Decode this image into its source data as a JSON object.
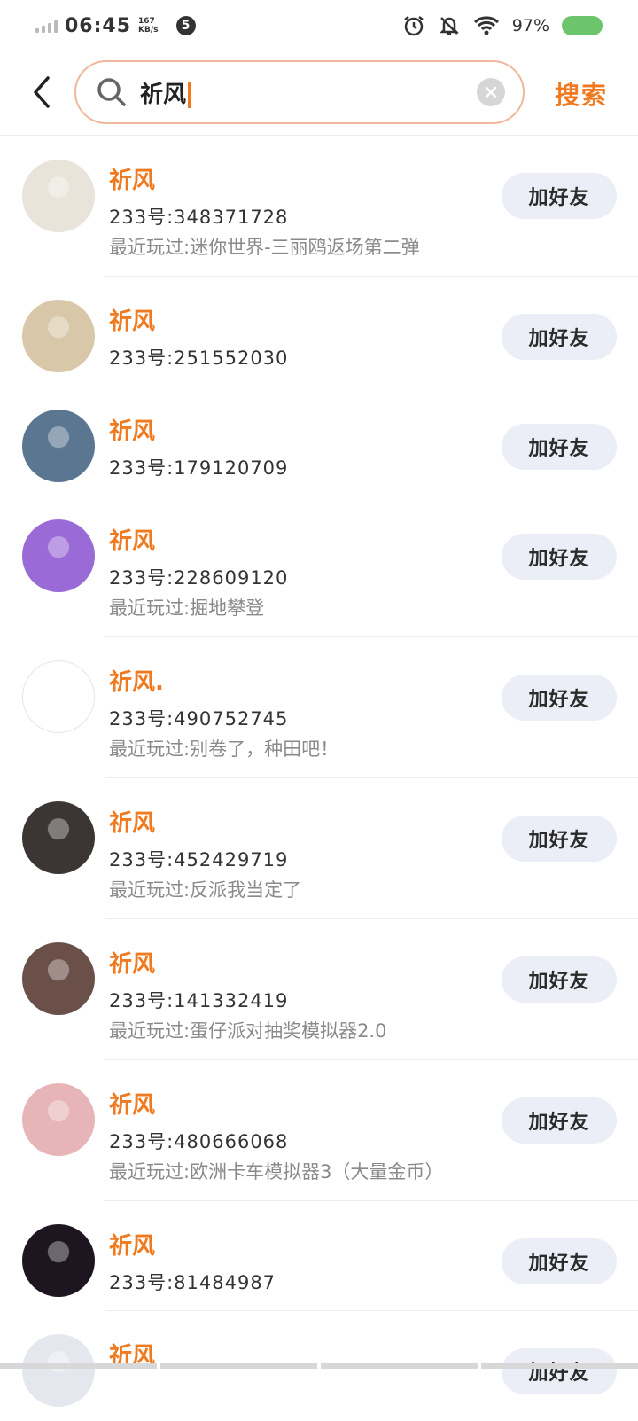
{
  "status_bar": {
    "time": "06:45",
    "speed_value": "167",
    "speed_unit": "KB/s",
    "notification_count": "5",
    "battery": "97%",
    "icons": [
      "signal-icon",
      "alarm-icon",
      "bell-off-icon",
      "wifi-icon",
      "battery-icon"
    ],
    "battery_color": "#6cc46c"
  },
  "header": {
    "back_icon": "chevron-left-icon",
    "search_query": "祈风",
    "search_button": "搜索",
    "accent_color": "#f07a1f"
  },
  "results": [
    {
      "name": "祈风",
      "uid": "233号:348371728",
      "recent": "最近玩过:迷你世界-三丽鸥返场第二弹",
      "button": "加好友",
      "avatar_bg": "#e9e4da"
    },
    {
      "name": "祈风",
      "uid": "233号:251552030",
      "recent": "",
      "button": "加好友",
      "avatar_bg": "#d8c7a8"
    },
    {
      "name": "祈风",
      "uid": "233号:179120709",
      "recent": "",
      "button": "加好友",
      "avatar_bg": "#5a7690"
    },
    {
      "name": "祈风",
      "uid": "233号:228609120",
      "recent": "最近玩过:掘地攀登",
      "button": "加好友",
      "avatar_bg": "#9a6ad6"
    },
    {
      "name": "祈风.",
      "uid": "233号:490752745",
      "recent": "最近玩过:别卷了，种田吧！",
      "button": "加好友",
      "avatar_bg": "#ffffff"
    },
    {
      "name": "祈风",
      "uid": "233号:452429719",
      "recent": "最近玩过:反派我当定了",
      "button": "加好友",
      "avatar_bg": "#3b3534"
    },
    {
      "name": "祈风",
      "uid": "233号:141332419",
      "recent": "最近玩过:蛋仔派对抽奖模拟器2.0",
      "button": "加好友",
      "avatar_bg": "#6b5049"
    },
    {
      "name": "祈风",
      "uid": "233号:480666068",
      "recent": "最近玩过:欧洲卡车模拟器3（大量金币）",
      "button": "加好友",
      "avatar_bg": "#e7b5b7"
    },
    {
      "name": "祈风",
      "uid": "233号:81484987",
      "recent": "",
      "button": "加好友",
      "avatar_bg": "#1d1620"
    },
    {
      "name": "祈风",
      "uid": "",
      "recent": "",
      "button": "加好友",
      "avatar_bg": "#e4e8ee"
    }
  ]
}
